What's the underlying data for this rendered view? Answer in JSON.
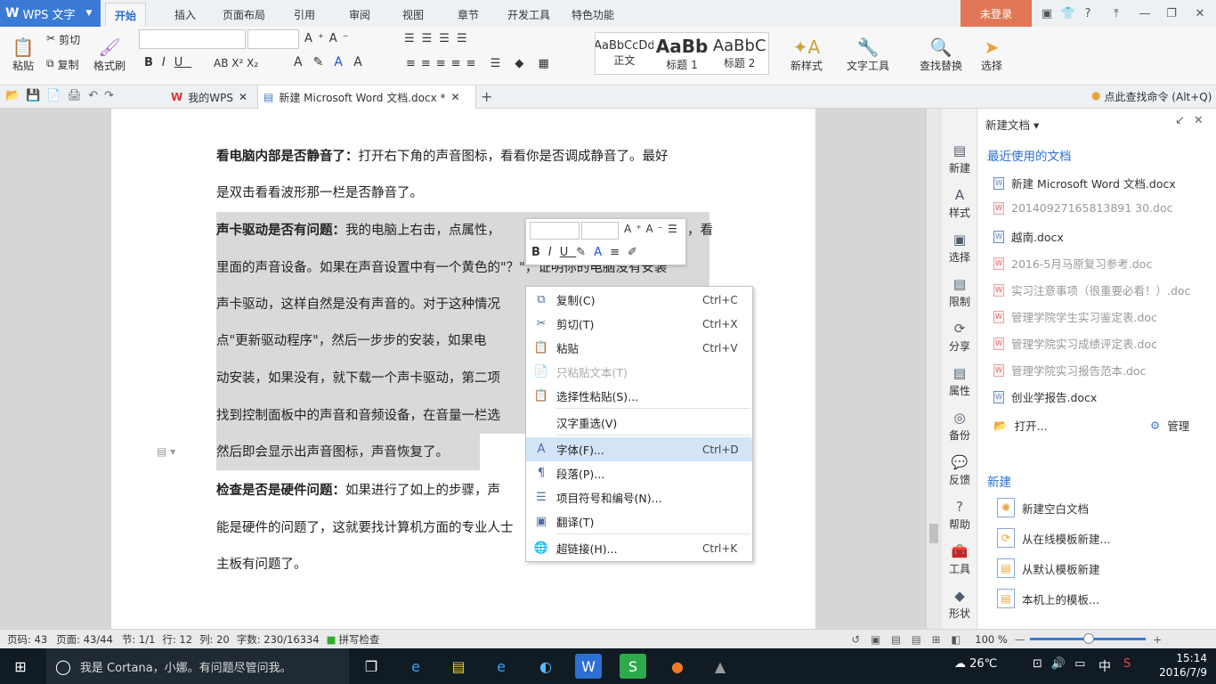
{
  "app": {
    "name": "WPS 文字",
    "logo": "W"
  },
  "ribbon_tabs": [
    "开始",
    "插入",
    "页面布局",
    "引用",
    "审阅",
    "视图",
    "章节",
    "开发工具",
    "特色功能"
  ],
  "login_label": "未登录",
  "ribbon": {
    "paste": "粘贴",
    "cut": "剪切",
    "copy": "复制",
    "format_painter": "格式刷",
    "styles": [
      {
        "preview": "AaBbCcDd",
        "label": "正文"
      },
      {
        "preview": "AaBb",
        "label": "标题 1"
      },
      {
        "preview": "AaBbC",
        "label": "标题 2"
      }
    ],
    "new_style": "新样式",
    "text_tools": "文字工具",
    "find_replace": "查找替换",
    "select": "选择"
  },
  "doc_tabs": [
    {
      "label": "我的WPS",
      "active": false
    },
    {
      "label": "新建 Microsoft Word 文档.docx *",
      "active": true
    }
  ],
  "command_search": "点此查找命令 (Alt+Q)",
  "document": {
    "lines": [
      {
        "bold": "看电脑内部是否静音了：",
        "text": "打开右下角的声音图标，看看你是否调成静音了。最好"
      },
      {
        "bold": "",
        "text": "是双击看看波形那一栏是否静音了。"
      },
      {
        "bold": "声卡驱动是否有问题：",
        "text": "我的电脑上右击，点属性，",
        "text_tail": "，看"
      },
      {
        "bold": "",
        "text": "里面的声音设备。如果在声音设置中有一个黄色的\"？\"，证明你的电脑没有安装"
      },
      {
        "bold": "",
        "text": "声卡驱动，这样自然是没有声音的。对于这种情况"
      },
      {
        "bold": "",
        "text": "点\"更新驱动程序\"，然后一步步的安装，如果电"
      },
      {
        "bold": "",
        "text": "动安装，如果没有，就下载一个声卡驱动，第二项"
      },
      {
        "bold": "",
        "text": "找到控制面板中的声音和音频设备，在音量一栏选"
      },
      {
        "bold": "",
        "text": "然后即会显示出声音图标，声音恢复了。"
      },
      {
        "bold": "检查是否是硬件问题：",
        "text": "如果进行了如上的步骤，声"
      },
      {
        "bold": "",
        "text": "能是硬件的问题了，这就要找计算机方面的专业人士"
      },
      {
        "bold": "",
        "text": "主板有问题了。"
      }
    ]
  },
  "context_menu": [
    {
      "icon": "copy-icon",
      "label": "复制(C)",
      "shortcut": "Ctrl+C",
      "disabled": false
    },
    {
      "icon": "cut-icon",
      "label": "剪切(T)",
      "shortcut": "Ctrl+X",
      "disabled": false
    },
    {
      "icon": "paste-icon",
      "label": "粘贴",
      "shortcut": "Ctrl+V",
      "disabled": false
    },
    {
      "icon": "paste-text-icon",
      "label": "只粘贴文本(T)",
      "shortcut": "",
      "disabled": true
    },
    {
      "icon": "paste-special-icon",
      "label": "选择性粘贴(S)...",
      "shortcut": "",
      "disabled": false
    },
    {
      "icon": "",
      "label": "汉字重选(V)",
      "shortcut": "",
      "disabled": false
    },
    {
      "icon": "font-icon",
      "label": "字体(F)...",
      "shortcut": "Ctrl+D",
      "disabled": false
    },
    {
      "icon": "paragraph-icon",
      "label": "段落(P)...",
      "shortcut": "",
      "disabled": false
    },
    {
      "icon": "bullets-icon",
      "label": "项目符号和编号(N)...",
      "shortcut": "",
      "disabled": false
    },
    {
      "icon": "translate-icon",
      "label": "翻译(T)",
      "shortcut": "",
      "disabled": false
    },
    {
      "icon": "hyperlink-icon",
      "label": "超链接(H)...",
      "shortcut": "Ctrl+K",
      "disabled": false
    }
  ],
  "sidebar_items": [
    "新建",
    "样式",
    "选择",
    "限制",
    "分享",
    "属性",
    "备份",
    "反馈",
    "帮助",
    "工具",
    "形状"
  ],
  "panel": {
    "title": "新建文档",
    "recent_heading": "最近使用的文档",
    "recent": [
      {
        "name": "新建 Microsoft Word 文档.docx",
        "dim": false
      },
      {
        "name": "20140927165813891 30.doc",
        "dim": true
      },
      {
        "name": "越南.docx",
        "dim": false
      },
      {
        "name": "2016-5月马原复习参考.doc",
        "dim": true
      },
      {
        "name": "实习注意事项（很重要必看！）.doc",
        "dim": true
      },
      {
        "name": "管理学院学生实习鉴定表.doc",
        "dim": true
      },
      {
        "name": "管理学院实习成绩评定表.doc",
        "dim": true
      },
      {
        "name": "管理学院实习报告范本.doc",
        "dim": true
      },
      {
        "name": "创业学报告.docx",
        "dim": false
      }
    ],
    "open": "打开...",
    "manage": "管理",
    "new_heading": "新建",
    "new_items": [
      "新建空白文档",
      "从在线模板新建...",
      "从默认模板新建",
      "本机上的模板..."
    ]
  },
  "status": {
    "page_code": "页码: 43",
    "page": "页面: 43/44",
    "section": "节: 1/1",
    "row": "行: 12",
    "col": "列: 20",
    "words": "字数: 230/16334",
    "spell": "拼写检查",
    "zoom": "100 %"
  },
  "taskbar": {
    "search": "我是 Cortana，小娜。有问题尽管问我。",
    "weather": "26℃",
    "ime": "中",
    "time": "15:14",
    "date": "2016/7/9"
  }
}
